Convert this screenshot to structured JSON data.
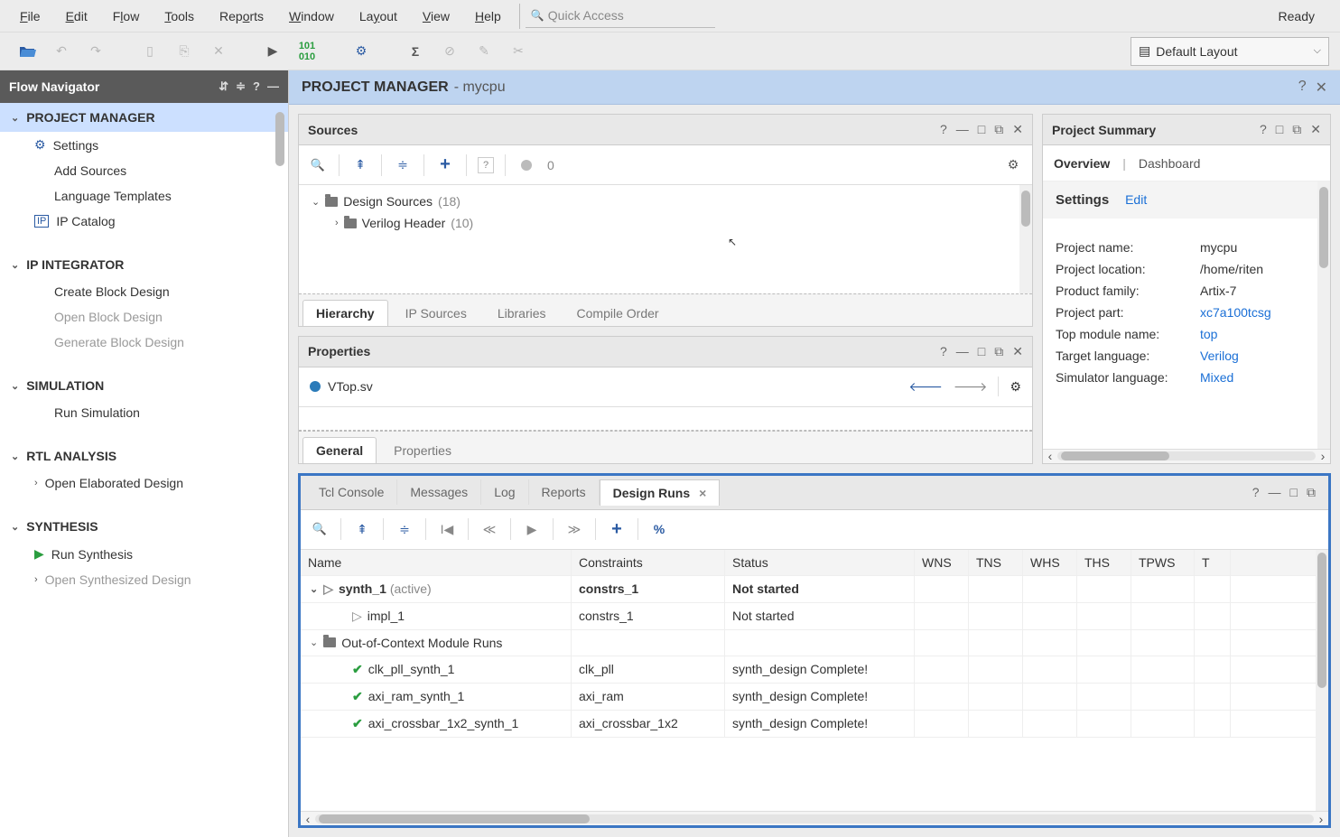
{
  "status": "Ready",
  "quick_access_placeholder": "Quick Access",
  "menu": [
    "File",
    "Edit",
    "Flow",
    "Tools",
    "Reports",
    "Window",
    "Layout",
    "View",
    "Help"
  ],
  "layout_selector": "Default Layout",
  "flow_nav": {
    "title": "Flow Navigator",
    "sections": [
      {
        "title": "PROJECT MANAGER",
        "highlighted": true,
        "items": [
          {
            "label": "Settings",
            "icon": "gear"
          },
          {
            "label": "Add Sources"
          },
          {
            "label": "Language Templates"
          },
          {
            "label": "IP Catalog",
            "icon": "ip"
          }
        ]
      },
      {
        "title": "IP INTEGRATOR",
        "items": [
          {
            "label": "Create Block Design"
          },
          {
            "label": "Open Block Design",
            "disabled": true
          },
          {
            "label": "Generate Block Design",
            "disabled": true
          }
        ]
      },
      {
        "title": "SIMULATION",
        "items": [
          {
            "label": "Run Simulation"
          }
        ]
      },
      {
        "title": "RTL ANALYSIS",
        "items": [
          {
            "label": "Open Elaborated Design",
            "chev": true
          }
        ]
      },
      {
        "title": "SYNTHESIS",
        "items": [
          {
            "label": "Run Synthesis",
            "icon": "play"
          },
          {
            "label": "Open Synthesized Design",
            "chev": true,
            "disabled": true
          }
        ]
      }
    ]
  },
  "pm": {
    "title": "PROJECT MANAGER",
    "sub": "- mycpu"
  },
  "sources": {
    "title": "Sources",
    "zeroBadge": "0",
    "tree": [
      {
        "label": "Design Sources",
        "count": "(18)",
        "expanded": true,
        "children": [
          {
            "label": "Verilog Header",
            "count": "(10)"
          }
        ]
      }
    ],
    "tabs": [
      "Hierarchy",
      "IP Sources",
      "Libraries",
      "Compile Order"
    ]
  },
  "properties": {
    "title": "Properties",
    "file": "VTop.sv",
    "tabs": [
      "General",
      "Properties"
    ]
  },
  "summary": {
    "title": "Project Summary",
    "tabs": [
      "Overview",
      "Dashboard"
    ],
    "section_title": "Settings",
    "edit": "Edit",
    "rows": [
      {
        "k": "Project name:",
        "v": "mycpu"
      },
      {
        "k": "Project location:",
        "v": "/home/riten"
      },
      {
        "k": "Product family:",
        "v": "Artix-7"
      },
      {
        "k": "Project part:",
        "v": "xc7a100tcsg",
        "link": true
      },
      {
        "k": "Top module name:",
        "v": "top",
        "link": true
      },
      {
        "k": "Target language:",
        "v": "Verilog",
        "link": true
      },
      {
        "k": "Simulator language:",
        "v": "Mixed",
        "link": true
      }
    ]
  },
  "console": {
    "tabs": [
      "Tcl Console",
      "Messages",
      "Log",
      "Reports",
      "Design Runs"
    ],
    "active": "Design Runs",
    "columns": [
      "Name",
      "Constraints",
      "Status",
      "WNS",
      "TNS",
      "WHS",
      "THS",
      "TPWS",
      "T"
    ],
    "rows": [
      {
        "name": "synth_1",
        "suffix": "(active)",
        "constraints": "constrs_1",
        "status": "Not started",
        "bold": true,
        "icon": "play",
        "exp": "down",
        "indent": 0
      },
      {
        "name": "impl_1",
        "constraints": "constrs_1",
        "status": "Not started",
        "icon": "play",
        "indent": 1
      },
      {
        "name": "Out-of-Context Module Runs",
        "icon": "folder",
        "exp": "down",
        "indent": 0
      },
      {
        "name": "clk_pll_synth_1",
        "constraints": "clk_pll",
        "status": "synth_design Complete!",
        "icon": "check",
        "indent": 1
      },
      {
        "name": "axi_ram_synth_1",
        "constraints": "axi_ram",
        "status": "synth_design Complete!",
        "icon": "check",
        "indent": 1
      },
      {
        "name": "axi_crossbar_1x2_synth_1",
        "constraints": "axi_crossbar_1x2",
        "status": "synth_design Complete!",
        "icon": "check",
        "indent": 1
      }
    ]
  }
}
